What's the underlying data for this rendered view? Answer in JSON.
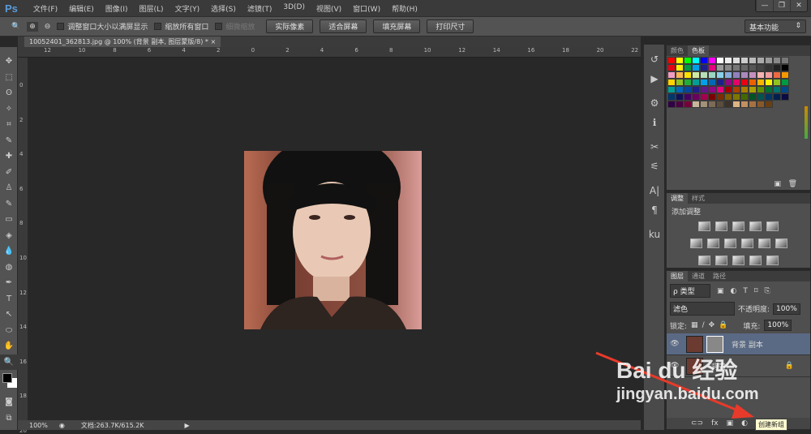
{
  "app": {
    "logo": "Ps",
    "menus": [
      "文件(F)",
      "编辑(E)",
      "图像(I)",
      "图层(L)",
      "文字(Y)",
      "选择(S)",
      "滤镜(T)",
      "3D(D)",
      "视图(V)",
      "窗口(W)",
      "帮助(H)"
    ],
    "window_buttons": [
      "—",
      "❐",
      "✕"
    ]
  },
  "options": {
    "zoom_icon": "🔍",
    "resize_windows": "调整窗口大小以满屏显示",
    "zoom_all": "缩放所有窗口",
    "scrubby_zoom": "细微缩放",
    "buttons": [
      "实际像素",
      "适合屏幕",
      "填充屏幕",
      "打印尺寸"
    ],
    "workspace": "基本功能"
  },
  "document": {
    "tab": "10052401_362813.jpg  @  100% (背景 副本, 图层蒙版/8) *",
    "close": "×"
  },
  "ruler": [
    "12",
    "10",
    "8",
    "6",
    "4",
    "2",
    "0",
    "2",
    "4",
    "6",
    "8",
    "10",
    "12",
    "14",
    "16",
    "18",
    "20",
    "22"
  ],
  "vruler": [
    "0",
    "2",
    "4",
    "6",
    "8",
    "10",
    "12",
    "14",
    "16",
    "18",
    "20"
  ],
  "tools": [
    "✥",
    "⬚",
    "ʘ",
    "✧",
    "⌗",
    "✎",
    "✚",
    "✐",
    "♙",
    "✎",
    "▭",
    "◈",
    "💧",
    "◍",
    "✒",
    "T",
    "↖",
    "⬭",
    "✋",
    "🔍"
  ],
  "status": {
    "zoom": "100%",
    "doc": "文档:263.7K/615.2K"
  },
  "dock_icons": [
    "↺",
    "▶",
    "⚙",
    "ℹ",
    "✂",
    "⚟",
    "A|",
    "¶",
    "ku"
  ],
  "swatches": {
    "tabs": [
      "颜色",
      "色板"
    ],
    "colors": [
      "#ff0000",
      "#ffff00",
      "#00ff00",
      "#00ffff",
      "#0000ff",
      "#ff00ff",
      "#ffffff",
      "#eeeeee",
      "#dddddd",
      "#cccccc",
      "#bbbbbb",
      "#aaaaaa",
      "#999999",
      "#888888",
      "#777777",
      "#e60012",
      "#fff100",
      "#009944",
      "#00a0e9",
      "#1d2088",
      "#e4007f",
      "#999999",
      "#888888",
      "#777777",
      "#666666",
      "#555555",
      "#444444",
      "#333333",
      "#222222",
      "#000000",
      "#f19ec2",
      "#f8b551",
      "#fce100",
      "#cfe9a0",
      "#b8e0b7",
      "#9cd6c3",
      "#8ad0e9",
      "#88abda",
      "#8f82bc",
      "#aa89bd",
      "#c490bf",
      "#f5b2b2",
      "#f29c9f",
      "#ec6941",
      "#f39800",
      "#ffd400",
      "#8fc31f",
      "#22ac38",
      "#009e96",
      "#00a0e9",
      "#0068b7",
      "#1d2088",
      "#920783",
      "#e5006a",
      "#e60012",
      "#eb6100",
      "#f8b500",
      "#fff100",
      "#8fc31f",
      "#009944",
      "#009e96",
      "#0068b7",
      "#00479d",
      "#1d2088",
      "#601986",
      "#920783",
      "#e4007f",
      "#a40000",
      "#a84200",
      "#a87d00",
      "#aba000",
      "#5b8f00",
      "#007130",
      "#00736d",
      "#004986",
      "#00366c",
      "#0e1258",
      "#440062",
      "#6a005f",
      "#a4004f",
      "#7d0000",
      "#7b2e00",
      "#7f5f00",
      "#7d7700",
      "#426900",
      "#005324",
      "#005450",
      "#003664",
      "#001f4e",
      "#0b0a43",
      "#300045",
      "#4b0043",
      "#78003a",
      "#c9b59b",
      "#a4917a",
      "#7d6b57",
      "#5b4c3c",
      "#3d3227",
      "#dcb584",
      "#c19060",
      "#a67243",
      "#885829",
      "#6a3f14"
    ]
  },
  "adjustments": {
    "tabs": [
      "调整",
      "样式"
    ],
    "title": "添加调整",
    "icons": [
      "☼",
      "▁▃▅",
      "⟋",
      "▨",
      "▽",
      "▦",
      "⚖",
      "◧",
      "◍",
      "◕",
      "▦",
      "◩",
      "▧",
      "▨",
      "◪",
      "▮"
    ]
  },
  "layers": {
    "tabs": [
      "图层",
      "通道",
      "路径"
    ],
    "filter": "ρ 类型",
    "blend": "滤色",
    "opacity_label": "不透明度:",
    "opacity": "100%",
    "lock_label": "锁定:",
    "fill_label": "填充:",
    "fill": "100%",
    "items": [
      {
        "name": "背景 副本",
        "selected": true
      },
      {
        "name": "背景",
        "selected": false
      }
    ]
  },
  "tooltip": "创建新组",
  "watermark": {
    "brand": "Bai du 经验",
    "url": "jingyan.baidu.com"
  }
}
